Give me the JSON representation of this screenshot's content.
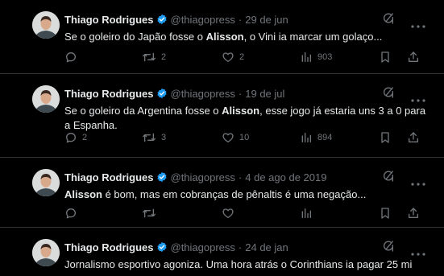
{
  "tweets": [
    {
      "author": "Thiago Rodrigues",
      "handle": "@thiagopress",
      "separator": "·",
      "date": "29 de jun",
      "text_before": "Se o goleiro do Japão fosse o ",
      "text_bold": "Alisson",
      "text_after": ", o Vini ia marcar um golaço...",
      "replies": "",
      "retweets": "2",
      "likes": "2",
      "views": "903"
    },
    {
      "author": "Thiago Rodrigues",
      "handle": "@thiagopress",
      "separator": "·",
      "date": "19 de jul",
      "text_before": "Se o goleiro da Argentina fosse o ",
      "text_bold": "Alisson",
      "text_after": ", esse jogo já estaria uns 3 a 0 para a Espanha.",
      "replies": "2",
      "retweets": "3",
      "likes": "10",
      "views": "894"
    },
    {
      "author": "Thiago Rodrigues",
      "handle": "@thiagopress",
      "separator": "·",
      "date": "4 de ago de 2019",
      "text_before": "",
      "text_bold": "Alisson",
      "text_after": " é bom, mas em cobranças de pênaltis é uma negação...",
      "replies": "",
      "retweets": "",
      "likes": "",
      "views": ""
    },
    {
      "author": "Thiago Rodrigues",
      "handle": "@thiagopress",
      "separator": "·",
      "date": "24 de jan",
      "text_before": "Jornalismo esportivo agoniza. Uma hora atrás o Corinthians ia pagar 25 mi",
      "text_bold": "",
      "text_after": "",
      "replies": "",
      "retweets": "",
      "likes": "",
      "views": ""
    }
  ],
  "colors": {
    "background": "#000000",
    "text": "#e7e9ea",
    "muted": "#71767b",
    "verified": "#1d9bf0",
    "divider": "#2f3336"
  },
  "icons": [
    "avatar",
    "verified-badge-icon",
    "grok-icon",
    "more-icon",
    "reply-icon",
    "retweet-icon",
    "like-icon",
    "views-icon",
    "bookmark-icon",
    "share-icon"
  ]
}
